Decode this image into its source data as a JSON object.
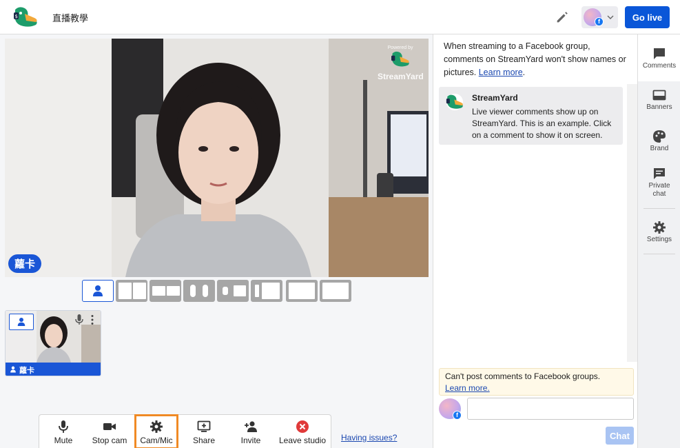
{
  "header": {
    "studio_title": "直播教學",
    "go_live_label": "Go live"
  },
  "stage": {
    "watermark_powered": "Powered by",
    "watermark_brand": "StreamYard",
    "host_name": "蘿卡"
  },
  "self_preview": {
    "name": "蘿卡"
  },
  "controls": {
    "mute": "Mute",
    "stop_cam": "Stop cam",
    "cam_mic": "Cam/Mic",
    "share": "Share",
    "invite": "Invite",
    "leave": "Leave studio"
  },
  "help_link": "Having issues?",
  "comments": {
    "notice": "When streaming to a Facebook group, comments on StreamYard won't show names or pictures.",
    "notice_link": "Learn more",
    "message": {
      "author": "StreamYard",
      "text": "Live viewer comments show up on StreamYard. This is an example. Click on a comment to show it on screen."
    },
    "warning": "Can't post comments to Facebook groups.",
    "warning_link": "Learn more.",
    "chat_button": "Chat"
  },
  "rail": {
    "comments": "Comments",
    "banners": "Banners",
    "brand": "Brand",
    "private_chat_1": "Private",
    "private_chat_2": "chat",
    "settings": "Settings"
  },
  "colors": {
    "primary": "#0a56d8",
    "highlight": "#f08a24",
    "leave_red": "#e03a3a"
  }
}
